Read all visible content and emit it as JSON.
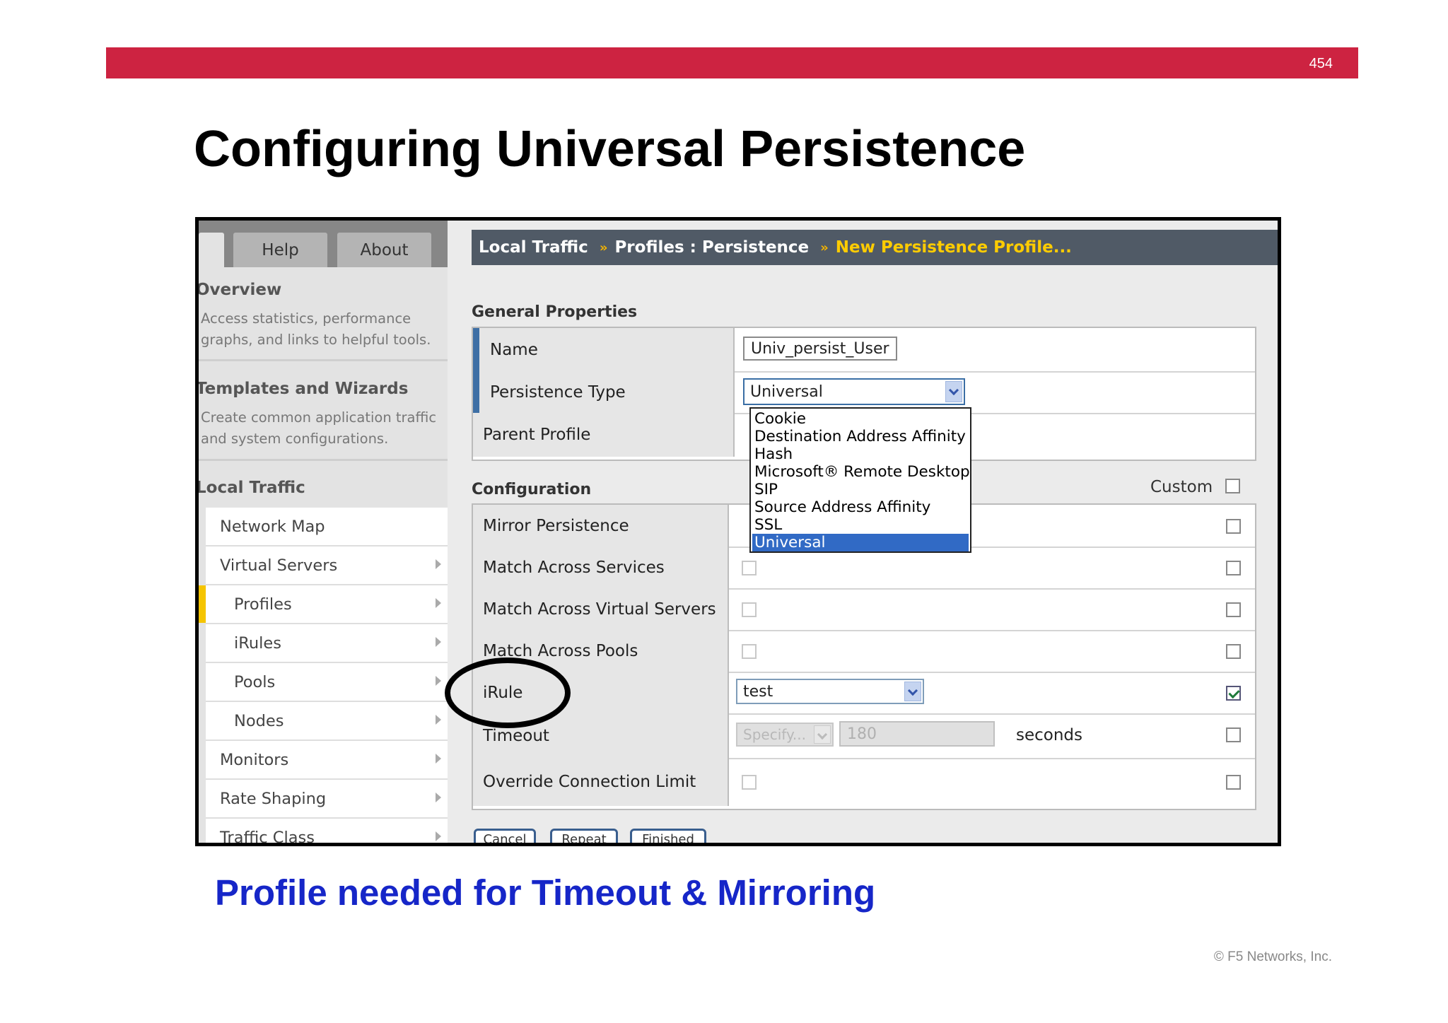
{
  "slide": {
    "page_number": "454",
    "title": "Configuring Universal Persistence",
    "caption": "Profile needed for Timeout & Mirroring",
    "copyright": "© F5 Networks, Inc.",
    "accent_color": "#cd2341",
    "caption_color": "#1626c8"
  },
  "tabs": {
    "help": "Help",
    "about": "About"
  },
  "sidebar": {
    "overview_title": "Overview",
    "overview_desc": "Access statistics, performance graphs, and links to helpful tools.",
    "templates_title": "Templates and Wizards",
    "templates_desc": "Create common application traffic and system configurations.",
    "local_traffic_title": "Local Traffic",
    "items": [
      {
        "label": "Network Map"
      },
      {
        "label": "Virtual Servers"
      },
      {
        "label": "Profiles"
      },
      {
        "label": "iRules"
      },
      {
        "label": "Pools"
      },
      {
        "label": "Nodes"
      },
      {
        "label": "Monitors"
      },
      {
        "label": "Rate Shaping"
      },
      {
        "label": "Traffic Class"
      }
    ]
  },
  "breadcrumb": {
    "part1": "Local Traffic",
    "part2": "Profiles : Persistence",
    "current": "New Persistence Profile..."
  },
  "general": {
    "heading": "General Properties",
    "name_label": "Name",
    "name_value": "Univ_persist_User",
    "type_label": "Persistence Type",
    "type_value": "Universal",
    "parent_label": "Parent Profile",
    "type_options": [
      "Cookie",
      "Destination Address Affinity",
      "Hash",
      "Microsoft® Remote Desktop",
      "SIP",
      "Source Address Affinity",
      "SSL",
      "Universal"
    ],
    "selected_option": "Universal"
  },
  "configuration": {
    "heading": "Configuration",
    "custom_label": "Custom",
    "mirror_label": "Mirror Persistence",
    "match_services_label": "Match Across Services",
    "match_vs_label": "Match Across Virtual Servers",
    "match_pools_label": "Match Across Pools",
    "irule_label": "iRule",
    "irule_value": "test",
    "timeout_label": "Timeout",
    "timeout_select": "Specify...",
    "timeout_value": "180",
    "timeout_unit": "seconds",
    "override_label": "Override Connection Limit"
  },
  "buttons": {
    "cancel": "Cancel",
    "repeat": "Repeat",
    "finished": "Finished"
  }
}
